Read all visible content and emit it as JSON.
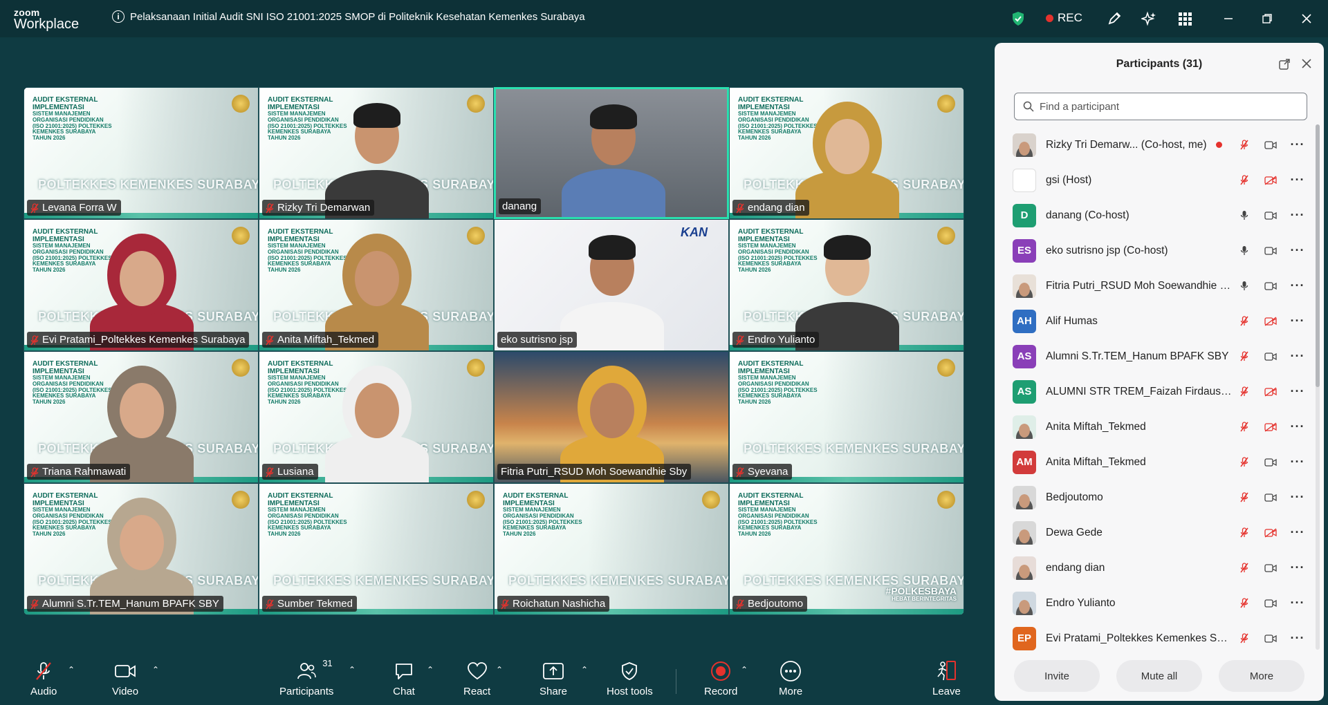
{
  "app": {
    "logo_line1": "zoom",
    "logo_line2": "Workplace"
  },
  "meeting": {
    "title": "Pelaksanaan Initial Audit SNI ISO 21001:2025 SMOP di Politeknik Kesehatan Kemenkes Surabaya"
  },
  "titlebar": {
    "rec_label": "REC"
  },
  "slide": {
    "line1": "AUDIT EKSTERNAL",
    "line2": "IMPLEMENTASI",
    "line3": "SISTEM MANAJEMEN ORGANISASI PENDIDIKAN (ISO 21001:2025) POLTEKKES KEMENKES SURABAYA TAHUN 2026",
    "brand": "POLTEKKES KEMENKES SURABAYA"
  },
  "tiles": [
    {
      "name": "Levana Forra W",
      "kind": "slide",
      "muted": true
    },
    {
      "name": "Rizky Tri Demarwan",
      "kind": "slide-person",
      "muted": true
    },
    {
      "name": "danang",
      "kind": "cam",
      "muted": false,
      "active": true
    },
    {
      "name": "endang dian",
      "kind": "slide-person",
      "muted": true
    },
    {
      "name": "Evi Pratami_Poltekkes Kemenkes Surabaya",
      "kind": "slide-person",
      "muted": true
    },
    {
      "name": "Anita Miftah_Tekmed",
      "kind": "slide-person",
      "muted": true
    },
    {
      "name": "eko sutrisno jsp",
      "kind": "cam-white",
      "muted": false
    },
    {
      "name": "Endro Yulianto",
      "kind": "slide-person",
      "muted": true
    },
    {
      "name": "Triana Rahmawati",
      "kind": "slide-person",
      "muted": true
    },
    {
      "name": "Lusiana",
      "kind": "slide-person",
      "muted": true
    },
    {
      "name": "Fitria Putri_RSUD Moh Soewandhie Sby",
      "kind": "cam-bridge",
      "muted": false
    },
    {
      "name": "Syevana",
      "kind": "slide",
      "muted": true
    },
    {
      "name": "Alumni S.Tr.TEM_Hanum BPAFK SBY",
      "kind": "slide-person",
      "muted": true
    },
    {
      "name": "Sumber Tekmed",
      "kind": "slide",
      "muted": true
    },
    {
      "name": "Roichatun Nashicha",
      "kind": "slide",
      "muted": true
    },
    {
      "name": "Bedjoutomo",
      "kind": "slide",
      "muted": true
    }
  ],
  "tile_extras": {
    "kan_logo": "KAN",
    "hashtag_line1": "#POLKESBAYA",
    "hashtag_line2": "HEBAT BERINTEGRITAS"
  },
  "participants": {
    "title": "Participants (31)",
    "search_placeholder": "Find a participant",
    "list": [
      {
        "name": "Rizky Tri Demarw...  (Co-host, me)",
        "initials": "",
        "color": "#d9d2cc",
        "mic": "muted",
        "cam": "on",
        "photo": true
      },
      {
        "name": "gsi (Host)",
        "initials": "",
        "color": "#ffffff",
        "mic": "muted",
        "cam": "off",
        "photo": false
      },
      {
        "name": "danang (Co-host)",
        "initials": "D",
        "color": "#1e9e72",
        "mic": "on",
        "cam": "on",
        "photo": false
      },
      {
        "name": "eko sutrisno jsp (Co-host)",
        "initials": "ES",
        "color": "#8a3fb8",
        "mic": "on",
        "cam": "on",
        "photo": false
      },
      {
        "name": "Fitria Putri_RSUD Moh Soewandhie S...",
        "initials": "",
        "color": "#e8e0d8",
        "mic": "on",
        "cam": "on",
        "photo": true
      },
      {
        "name": "Alif Humas",
        "initials": "AH",
        "color": "#2f6ec2",
        "mic": "muted",
        "cam": "off",
        "photo": false
      },
      {
        "name": "Alumni S.Tr.TEM_Hanum BPAFK SBY",
        "initials": "AS",
        "color": "#8a3fb8",
        "mic": "muted",
        "cam": "on",
        "photo": false
      },
      {
        "name": "ALUMNI STR TREM_Faizah Firdausi ...",
        "initials": "AS",
        "color": "#1e9e72",
        "mic": "muted",
        "cam": "off",
        "photo": false
      },
      {
        "name": "Anita Miftah_Tekmed",
        "initials": "",
        "color": "#dfeee8",
        "mic": "muted",
        "cam": "off",
        "photo": true
      },
      {
        "name": "Anita Miftah_Tekmed",
        "initials": "AM",
        "color": "#d23b3b",
        "mic": "muted",
        "cam": "on",
        "photo": false
      },
      {
        "name": "Bedjoutomo",
        "initials": "",
        "color": "#d8d8d8",
        "mic": "muted",
        "cam": "on",
        "photo": true
      },
      {
        "name": "Dewa Gede",
        "initials": "",
        "color": "#d8d8d8",
        "mic": "muted",
        "cam": "off",
        "photo": true
      },
      {
        "name": "endang dian",
        "initials": "",
        "color": "#e7dcd8",
        "mic": "muted",
        "cam": "on",
        "photo": true
      },
      {
        "name": "Endro Yulianto",
        "initials": "",
        "color": "#cfd8e0",
        "mic": "muted",
        "cam": "on",
        "photo": true
      },
      {
        "name": "Evi Pratami_Poltekkes Kemenkes Sur...",
        "initials": "EP",
        "color": "#e0661e",
        "mic": "muted",
        "cam": "on",
        "photo": false
      }
    ],
    "buttons": {
      "invite": "Invite",
      "mute_all": "Mute all",
      "more": "More"
    }
  },
  "toolbar": {
    "audio": "Audio",
    "video": "Video",
    "participants": "Participants",
    "participants_count": "31",
    "chat": "Chat",
    "react": "React",
    "share": "Share",
    "host_tools": "Host tools",
    "record": "Record",
    "more": "More",
    "leave": "Leave"
  },
  "colors": {
    "background": "#0f3b42",
    "active_speaker": "#2be0b0",
    "record_red": "#e5322d",
    "panel": "#f7f7f8"
  }
}
